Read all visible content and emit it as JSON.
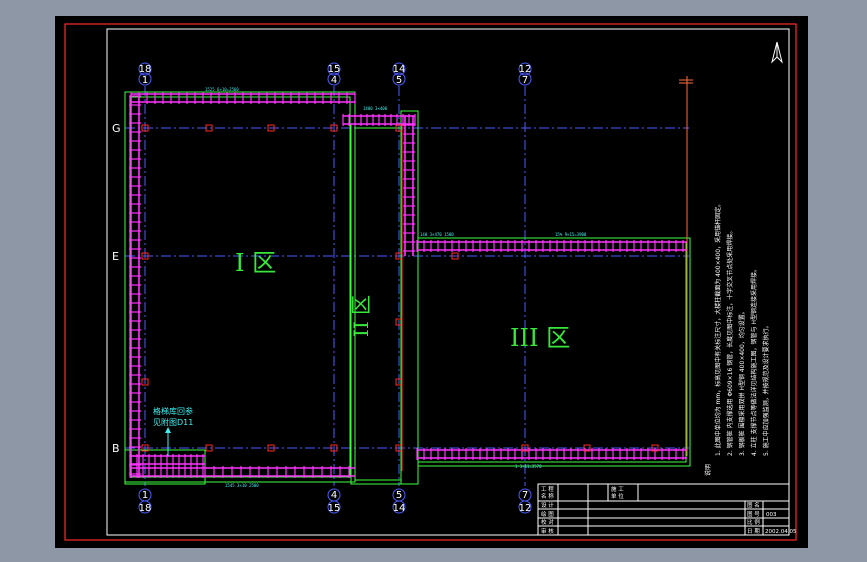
{
  "zones": [
    {
      "id": "zone-1",
      "label": "I 区"
    },
    {
      "id": "zone-2",
      "label": "II 区"
    },
    {
      "id": "zone-3",
      "label": "III 区"
    }
  ],
  "axes_top": [
    {
      "a": "18",
      "b": "1"
    },
    {
      "a": "15",
      "b": "4"
    },
    {
      "a": "14",
      "b": "5"
    },
    {
      "a": "12",
      "b": "7"
    }
  ],
  "axes_bottom": [
    {
      "a": "1",
      "b": "18"
    },
    {
      "a": "4",
      "b": "15"
    },
    {
      "a": "5",
      "b": "14"
    },
    {
      "a": "7",
      "b": "12"
    }
  ],
  "axes_left": [
    "G",
    "E",
    "B"
  ],
  "annotation": {
    "line1": "格梯库回参",
    "line2": "见附图D11"
  },
  "notes_title": "说明",
  "notes": [
    "1. 此图中单位均为 mm，标高见图中有关标注尺寸，大楼柱截面为 400×400，采用锚杆固定。",
    "2. 钢管桩 内支撑选用 Φ609×16 钢管，长度见图中标注，十字交叉节点处采用焊接。",
    "3. 钢板桩 围檩采用双拼 H型钢 400×400，均匀设置。",
    "4. 立柱 支撑节点等做法详见结构施工图，钢管与 H型钢连接采用焊接。",
    "5. 施工中应加强监测，并按规范及设计要求执行。"
  ],
  "title_block": {
    "r1": [
      "工 程",
      "名 称",
      "施 工",
      "单 位"
    ],
    "r2": [
      "设 计",
      "绘 图",
      "校 对",
      "审 核"
    ],
    "r3": [
      "图 名",
      "图 号",
      "比 例",
      "日 期"
    ],
    "drawing_no": "003",
    "date": "2002.04.05"
  },
  "colors": {
    "support": "#ff33ff",
    "column": "#ff2a2a",
    "outline": "#3cff3c",
    "axis": "#4a5cff",
    "dim": "#40f0f0",
    "text": "#ffffff",
    "zone": "#36e83a"
  }
}
